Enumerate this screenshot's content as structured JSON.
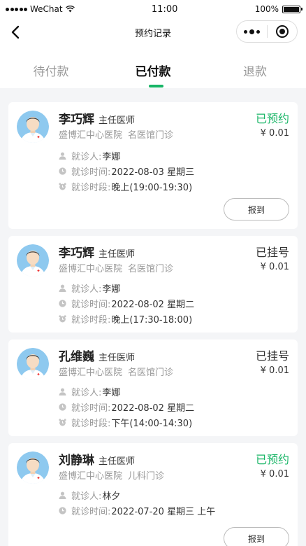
{
  "statusbar": {
    "carrier": "WeChat",
    "time": "11:00",
    "battery": "100%"
  },
  "nav": {
    "title": "预约记录"
  },
  "tabs": [
    {
      "label": "待付款",
      "active": false
    },
    {
      "label": "已付款",
      "active": true
    },
    {
      "label": "退款",
      "active": false
    }
  ],
  "colors": {
    "accent": "#18b566",
    "booked": "#18b566",
    "registered": "#333333"
  },
  "labels": {
    "patient": "就诊人:",
    "time": "就诊时间:",
    "period": "就诊时段:",
    "checkin": "报到"
  },
  "records": [
    {
      "doctor": "李巧辉",
      "title": "主任医师",
      "hospital": "盛博汇中心医院",
      "dept": "名医馆门诊",
      "status": "已预约",
      "price": "¥ 0.01",
      "patient": "李娜",
      "date": "2022-08-03 星期三",
      "period": "晚上(19:00-19:30)"
    },
    {
      "doctor": "李巧辉",
      "title": "主任医师",
      "hospital": "盛博汇中心医院",
      "dept": "名医馆门诊",
      "status": "已挂号",
      "price": "¥ 0.01",
      "patient": "李娜",
      "date": "2022-08-02 星期二",
      "period": "晚上(17:30-18:00)"
    },
    {
      "doctor": "孔维巍",
      "title": "主任医师",
      "hospital": "盛博汇中心医院",
      "dept": "名医馆门诊",
      "status": "已挂号",
      "price": "¥ 0.01",
      "patient": "李娜",
      "date": "2022-08-02 星期二",
      "period": "下午(14:00-14:30)"
    },
    {
      "doctor": "刘静琳",
      "title": "主任医师",
      "hospital": "盛博汇中心医院",
      "dept": "儿科门诊",
      "status": "已预约",
      "price": "¥ 0.01",
      "patient": "林夕",
      "date": "2022-07-20 星期三 上午"
    }
  ]
}
